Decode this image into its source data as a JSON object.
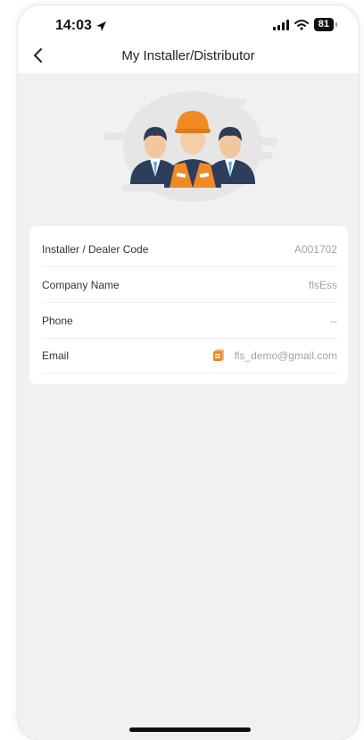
{
  "status_bar": {
    "time": "14:03",
    "battery": "81",
    "icons": [
      "location-arrow-icon",
      "signal-icon",
      "wifi-icon",
      "battery-icon"
    ]
  },
  "header": {
    "title": "My Installer/Distributor",
    "back_icon": "chevron-left-icon"
  },
  "illustration": {
    "icon": "installer-team-illustration"
  },
  "info": {
    "rows": [
      {
        "label": "Installer / Dealer Code",
        "value": "A001702"
      },
      {
        "label": "Company Name",
        "value": "flsEss"
      },
      {
        "label": "Phone",
        "value": "--"
      },
      {
        "label": "Email",
        "value": "fls_demo@gmail.com",
        "action_icon": "copy-icon"
      }
    ]
  },
  "colors": {
    "background": "#f1f1f1",
    "card": "#ffffff",
    "accent_orange": "#f08a24",
    "label_text": "#333333",
    "value_text": "#a3a3a3"
  }
}
